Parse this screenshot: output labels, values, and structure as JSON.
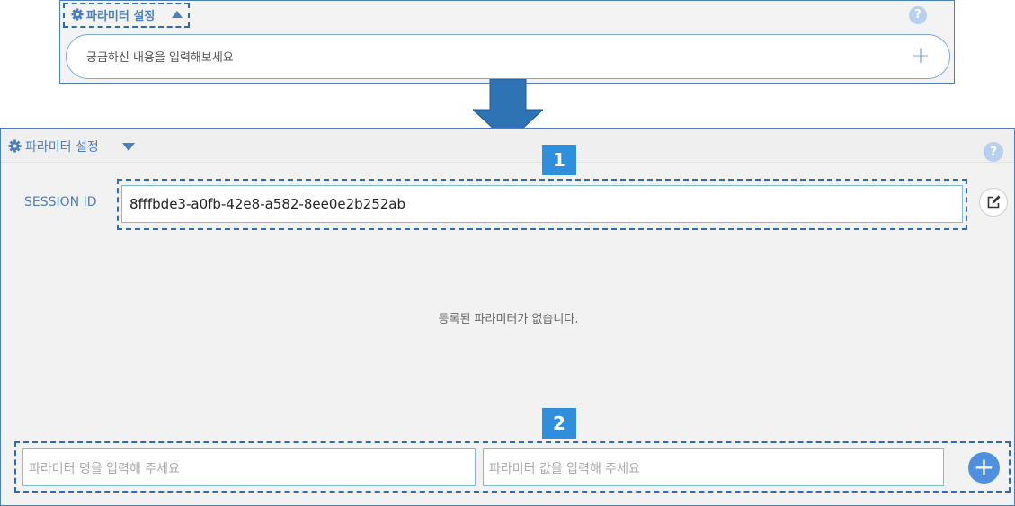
{
  "top_panel": {
    "title": "파라미터 설정",
    "help_label": "?",
    "input_placeholder": "궁금하신 내용을 입력해보세요",
    "add_label": "+"
  },
  "main_panel": {
    "title": "파라미터 설정",
    "help_label": "?",
    "badge_1": "1",
    "badge_2": "2",
    "session_label": "SESSION ID",
    "session_value": "8fffbde3-a0fb-42e8-a582-8ee0e2b252ab",
    "empty_message": "등록된 파라미터가 없습니다.",
    "param_name_placeholder": "파라미터 명을 입력해 주세요",
    "param_value_placeholder": "파라미터 값을 입력해 주세요",
    "add_label": "+"
  },
  "colors": {
    "accent": "#4a7fc1",
    "badge": "#2f8fdc",
    "arrow": "#2e74b5"
  }
}
